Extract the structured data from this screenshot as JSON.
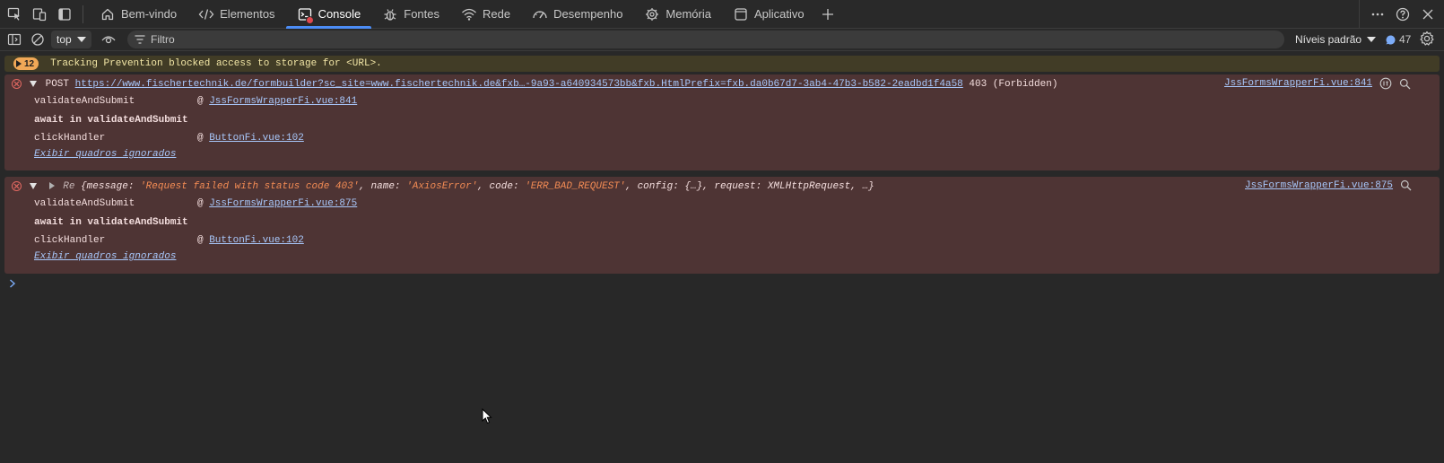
{
  "tabs": [
    {
      "id": "welcome",
      "label": "Bem-vindo",
      "icon": "home-icon"
    },
    {
      "id": "elements",
      "label": "Elementos",
      "icon": "code-icon"
    },
    {
      "id": "console",
      "label": "Console",
      "icon": "console-icon",
      "active": true
    },
    {
      "id": "sources",
      "label": "Fontes",
      "icon": "bug-icon"
    },
    {
      "id": "network",
      "label": "Rede",
      "icon": "wifi-icon"
    },
    {
      "id": "performance",
      "label": "Desempenho",
      "icon": "gauge-icon"
    },
    {
      "id": "memory",
      "label": "Memória",
      "icon": "chip-icon"
    },
    {
      "id": "application",
      "label": "Aplicativo",
      "icon": "app-window-icon"
    }
  ],
  "toolbar": {
    "context": "top",
    "filter_placeholder": "Filtro",
    "levels": "Níveis padrão",
    "issues_count": "47"
  },
  "warning": {
    "count": "12",
    "text": "Tracking Prevention blocked access to storage for <URL>."
  },
  "error1": {
    "method": "POST",
    "url": "https://www.fischertechnik.de/formbuilder?sc_site=www.fischertechnik.de&fxb…-9a93-a640934573bb&fxb.HtmlPrefix=fxb.da0b67d7-3ab4-47b3-b582-2eadbd1f4a58",
    "status": "403 (Forbidden)",
    "source": "JssFormsWrapperFi.vue:841",
    "stack": [
      {
        "fn": "validateAndSubmit",
        "loc": "JssFormsWrapperFi.vue:841"
      },
      {
        "fn": "await in validateAndSubmit",
        "loc": ""
      },
      {
        "fn": "clickHandler",
        "loc": "ButtonFi.vue:102"
      }
    ],
    "ignored": "Exibir quadros ignorados"
  },
  "error2": {
    "prefix": "Re",
    "obj_open": "{",
    "k_message": "message",
    "v_message": "'Request failed with status code 403'",
    "k_name": "name",
    "v_name": "'AxiosError'",
    "k_code": "code",
    "v_code": "'ERR_BAD_REQUEST'",
    "k_config": "config",
    "v_config": "{…}",
    "k_request": "request",
    "v_request": "XMLHttpRequest",
    "obj_tail": "…}",
    "source": "JssFormsWrapperFi.vue:875",
    "stack": [
      {
        "fn": "validateAndSubmit",
        "loc": "JssFormsWrapperFi.vue:875"
      },
      {
        "fn": "await in validateAndSubmit",
        "loc": ""
      },
      {
        "fn": "clickHandler",
        "loc": "ButtonFi.vue:102"
      }
    ],
    "ignored": "Exibir quadros ignorados"
  },
  "colors": {
    "accent": "#4c8df6",
    "error_bg": "#4e3434",
    "warning_bg": "#413c26",
    "link": "#a8c7fa"
  }
}
